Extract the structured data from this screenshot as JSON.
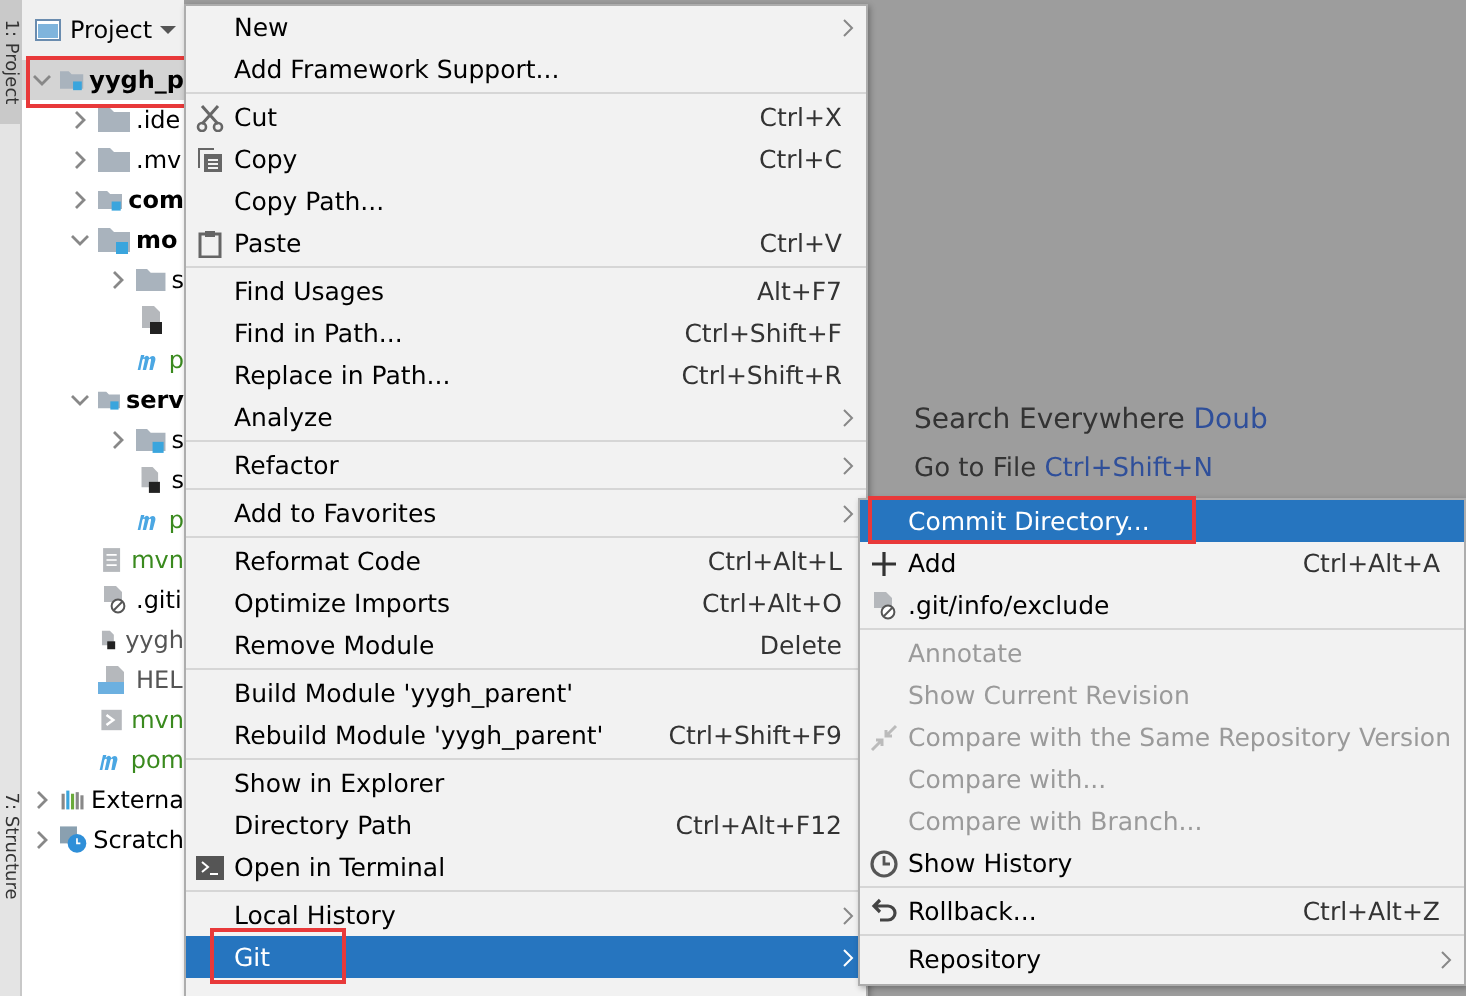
{
  "tool_strip": {
    "top_tab": "1: Project",
    "bottom_tab": "7: Structure"
  },
  "project_panel": {
    "title": "Project",
    "tree": [
      {
        "label": "yygh_p",
        "kind": "module",
        "bold": true,
        "expanded": true,
        "selected": true,
        "marked": true,
        "color": "#000000",
        "children": [
          {
            "label": ".ide",
            "kind": "folder",
            "bold": false,
            "expanded": false,
            "selected": false,
            "color": "#000000"
          },
          {
            "label": ".mv",
            "kind": "folder",
            "bold": false,
            "expanded": false,
            "selected": false,
            "color": "#000000"
          },
          {
            "label": "com",
            "kind": "module",
            "bold": true,
            "expanded": false,
            "selected": false,
            "color": "#000000"
          },
          {
            "label": "mo",
            "kind": "module",
            "bold": true,
            "expanded": true,
            "selected": false,
            "color": "#000000",
            "children": [
              {
                "label": "s",
                "kind": "folder",
                "expanded": false,
                "selected": false,
                "color": "#000000"
              },
              {
                "kind": "file",
                "selected": false
              },
              {
                "label": "p",
                "kind": "pom",
                "selected": false,
                "color": "#3a8a1e"
              }
            ]
          },
          {
            "label": "serv",
            "kind": "module",
            "bold": true,
            "expanded": true,
            "selected": false,
            "color": "#000000",
            "children": [
              {
                "label": "s",
                "kind": "module",
                "expanded": false,
                "selected": false,
                "color": "#000000"
              },
              {
                "label": "s",
                "kind": "file",
                "selected": false,
                "color": "#000000"
              },
              {
                "label": "p",
                "kind": "pom",
                "selected": false,
                "color": "#3a8a1e"
              }
            ]
          },
          {
            "label": "mvn",
            "kind": "text",
            "bold": false,
            "selected": false,
            "color": "#3a8a1e"
          },
          {
            "label": ".giti",
            "kind": "ignore",
            "bold": false,
            "selected": false,
            "color": "#000000"
          },
          {
            "label": "yygh",
            "kind": "file",
            "bold": false,
            "selected": false,
            "color": "#555555"
          },
          {
            "label": "HEL",
            "kind": "markdown",
            "bold": false,
            "selected": false,
            "color": "#555555"
          },
          {
            "label": "mvn",
            "kind": "script",
            "bold": false,
            "selected": false,
            "color": "#3a8a1e"
          },
          {
            "label": "pom",
            "kind": "pom",
            "bold": false,
            "selected": false,
            "color": "#3a8a1e"
          }
        ]
      },
      {
        "label": "Externa",
        "kind": "library",
        "bold": false,
        "expanded": false,
        "selected": false,
        "color": "#000000"
      },
      {
        "label": "Scratch",
        "kind": "scratch",
        "bold": false,
        "expanded": false,
        "selected": false,
        "color": "#000000"
      }
    ]
  },
  "editor": {
    "hint": "Search Everywhere",
    "hint_key": "Doub",
    "hint2": "Go to File",
    "hint2_key": "Ctrl+Shift+N"
  },
  "context_menu": [
    [
      {
        "label": "New",
        "submenu": true,
        "selected": false
      },
      {
        "label": "Add Framework Support...",
        "selected": false
      }
    ],
    [
      {
        "label": "Cut",
        "shortcut": "Ctrl+X",
        "selected": false
      },
      {
        "label": "Copy",
        "shortcut": "Ctrl+C",
        "selected": false
      },
      {
        "label": "Copy Path...",
        "selected": false
      },
      {
        "label": "Paste",
        "shortcut": "Ctrl+V",
        "selected": false
      }
    ],
    [
      {
        "label": "Find Usages",
        "shortcut": "Alt+F7",
        "selected": false
      },
      {
        "label": "Find in Path...",
        "shortcut": "Ctrl+Shift+F",
        "selected": false
      },
      {
        "label": "Replace in Path...",
        "shortcut": "Ctrl+Shift+R",
        "selected": false
      },
      {
        "label": "Analyze",
        "submenu": true,
        "selected": false
      }
    ],
    [
      {
        "label": "Refactor",
        "submenu": true,
        "selected": false
      }
    ],
    [
      {
        "label": "Add to Favorites",
        "submenu": true,
        "selected": false
      }
    ],
    [
      {
        "label": "Reformat Code",
        "shortcut": "Ctrl+Alt+L",
        "selected": false
      },
      {
        "label": "Optimize Imports",
        "shortcut": "Ctrl+Alt+O",
        "selected": false
      },
      {
        "label": "Remove Module",
        "shortcut": "Delete",
        "selected": false
      }
    ],
    [
      {
        "label": "Build Module 'yygh_parent'",
        "selected": false
      },
      {
        "label": "Rebuild Module 'yygh_parent'",
        "shortcut": "Ctrl+Shift+F9",
        "selected": false
      }
    ],
    [
      {
        "label": "Show in Explorer",
        "selected": false
      },
      {
        "label": "Directory Path",
        "shortcut": "Ctrl+Alt+F12",
        "selected": false
      },
      {
        "label": "Open in Terminal",
        "selected": false
      }
    ],
    [
      {
        "label": "Local History",
        "submenu": true,
        "selected": false
      },
      {
        "label": "Git",
        "submenu": true,
        "selected": true,
        "marked": true
      }
    ]
  ],
  "git_submenu": [
    [
      {
        "label": "Commit Directory...",
        "selected": true,
        "disabled": false,
        "marked": true
      },
      {
        "label": "Add",
        "shortcut": "Ctrl+Alt+A",
        "selected": false,
        "disabled": false
      },
      {
        "label": ".git/info/exclude",
        "selected": false,
        "disabled": false
      }
    ],
    [
      {
        "label": "Annotate",
        "selected": false,
        "disabled": true
      },
      {
        "label": "Show Current Revision",
        "selected": false,
        "disabled": true
      },
      {
        "label": "Compare with the Same Repository Version",
        "selected": false,
        "disabled": true
      },
      {
        "label": "Compare with...",
        "selected": false,
        "disabled": true
      },
      {
        "label": "Compare with Branch...",
        "selected": false,
        "disabled": true
      },
      {
        "label": "Show History",
        "selected": false,
        "disabled": false
      }
    ],
    [
      {
        "label": "Rollback...",
        "shortcut": "Ctrl+Alt+Z",
        "selected": false,
        "disabled": false
      }
    ],
    [
      {
        "label": "Repository",
        "submenu": true,
        "selected": false,
        "disabled": false
      }
    ]
  ]
}
